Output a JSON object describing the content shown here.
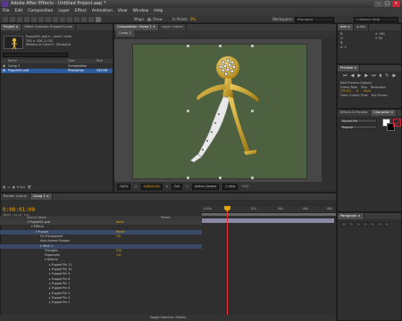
{
  "window": {
    "title": "Adobe After Effects - Untitled Project.aep *",
    "buttons": [
      "–",
      "□",
      "×"
    ]
  },
  "menu": [
    "File",
    "Edit",
    "Composition",
    "Layer",
    "Effect",
    "Animation",
    "View",
    "Window",
    "Help"
  ],
  "toolbar": {
    "magic_label": "Magic",
    "show_label": "Show",
    "inpoints_label": "In Points",
    "inpoints_value": "0%",
    "workspace_label": "Workspace:",
    "workspace_value": "Standard",
    "search_placeholder": "Search Help"
  },
  "project_panel": {
    "tabs": [
      "Project ×",
      "Effect Controls: Puppet01.psd"
    ],
    "item_name": "Puppet01.psd ▾ , used 1 time",
    "item_dims": "350 × 426 (1.00)",
    "item_color": "Millions of Colors+ (Straight)",
    "columns": {
      "name": "Name",
      "type": "Type",
      "size": "Size"
    },
    "items": [
      {
        "name": "Comp 1",
        "type": "Composition",
        "size": ""
      },
      {
        "name": "Puppet01.psd",
        "type": "Photoshop",
        "size": "330 KB"
      }
    ],
    "footer": "8 bpc"
  },
  "viewer": {
    "tabs": [
      "Composition: Comp 1 ×",
      "Layer: (none)"
    ],
    "comp_tab": "Comp 1",
    "footer": {
      "zoom": "100%",
      "timecode": "0;00;01;00",
      "quality": "Full",
      "camera": "Active Camera",
      "views": "1 View",
      "offset": "+0.0"
    }
  },
  "info_panel": {
    "tabs": [
      "Info ×",
      "Audio"
    ],
    "rgb": [
      "R:",
      "G:",
      "B:",
      "A: 0"
    ],
    "xy": [
      "X: 481",
      "Y: 95"
    ]
  },
  "preview_panel": {
    "tabs": [
      "Preview ×"
    ],
    "ram_label": "RAM Preview Options",
    "frame_rate_label": "Frame Rate",
    "frame_rate_value": "(29.97)",
    "skip_label": "Skip",
    "skip_value": "0",
    "resolution_label": "Resolution",
    "resolution_value": "Auto",
    "from_current": "From Current Time",
    "full_screen": "Full Screen"
  },
  "effects_panel": {
    "tabs": [
      "Effects & Presets",
      "Character ×"
    ],
    "font_value": "Myriad Pro",
    "style_value": "Regular"
  },
  "timeline": {
    "tabs": [
      "Render Queue",
      "Comp 1 ×"
    ],
    "timecode": "0:00:01:00",
    "timecode_sub": "00030 (29.97 fps)",
    "header": {
      "source": "Source Name",
      "parent": "Parent"
    },
    "ruler_labels": [
      "0:00s",
      "02s",
      "04s",
      "06s",
      "08s"
    ],
    "rows": [
      {
        "indent": 0,
        "label": "1   Puppet01.psd",
        "value": "None",
        "kind": "layer"
      },
      {
        "indent": 1,
        "label": "▾ Effects",
        "value": ""
      },
      {
        "indent": 2,
        "label": "▾ Puppet",
        "value": "Reset",
        "kind": "sel"
      },
      {
        "indent": 3,
        "label": "On Transparent",
        "value": "Off"
      },
      {
        "indent": 3,
        "label": "Auto-traced Shapes",
        "value": ""
      },
      {
        "indent": 3,
        "label": "▾ Mesh 1",
        "value": "",
        "kind": "sel"
      },
      {
        "indent": 4,
        "label": "Triangles",
        "value": "350"
      },
      {
        "indent": 4,
        "label": "Expansion",
        "value": "1.6"
      },
      {
        "indent": 4,
        "label": "▾ Deform",
        "value": ""
      },
      {
        "indent": 5,
        "label": "▸ Puppet Pin 11",
        "value": ""
      },
      {
        "indent": 5,
        "label": "▸ Puppet Pin 10",
        "value": ""
      },
      {
        "indent": 5,
        "label": "▸ Puppet Pin 9",
        "value": ""
      },
      {
        "indent": 5,
        "label": "▸ Puppet Pin 8",
        "value": ""
      },
      {
        "indent": 5,
        "label": "▸ Puppet Pin 7",
        "value": ""
      },
      {
        "indent": 5,
        "label": "▸ Puppet Pin 6",
        "value": ""
      },
      {
        "indent": 5,
        "label": "▸ Puppet Pin 5",
        "value": ""
      },
      {
        "indent": 5,
        "label": "▸ Puppet Pin 4",
        "value": ""
      },
      {
        "indent": 5,
        "label": "▸ Puppet Pin 3",
        "value": ""
      }
    ],
    "footer": "Toggle Switches / Modes"
  },
  "paragraph_panel": {
    "tabs": [
      "Paragraph ×"
    ]
  },
  "colors": {
    "accent_time": "#e8a300",
    "selection": "#2d5b9d",
    "canvas": "#4d6040"
  }
}
